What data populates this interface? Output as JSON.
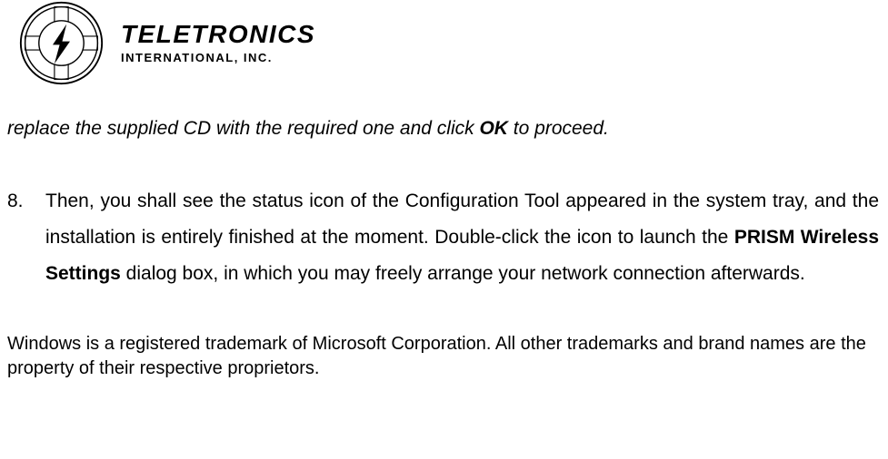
{
  "logo": {
    "title": "TELETRONICS",
    "subtitle": "INTERNATIONAL, INC."
  },
  "instruction_fragment": {
    "pre": "replace the supplied CD with the required one and click ",
    "ok": "OK",
    "post": " to proceed."
  },
  "step": {
    "number": "8.",
    "pre": "Then, you shall see the status icon of the Configuration Tool appeared in the system tray, and the installation is entirely finished at the moment. Double-click the icon to launch the ",
    "bold": "PRISM Wireless Settings",
    "post": " dialog box, in which you may freely arrange your network connection afterwards."
  },
  "trademark_notice": "Windows is a registered trademark of Microsoft Corporation. All other trademarks and brand names are the property of their respective proprietors."
}
